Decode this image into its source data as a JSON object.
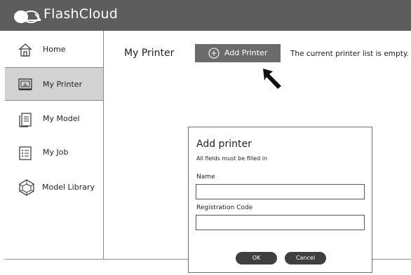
{
  "app": {
    "title": "FlashCloud"
  },
  "sidebar": {
    "items": [
      {
        "label": "Home",
        "icon": "home-icon"
      },
      {
        "label": "My Printer",
        "icon": "printer-icon",
        "active": true
      },
      {
        "label": "My Model",
        "icon": "document-icon"
      },
      {
        "label": "My Job",
        "icon": "list-icon"
      },
      {
        "label": "Model Library",
        "icon": "model-library-icon"
      }
    ]
  },
  "main": {
    "heading": "My Printer",
    "add_button": "Add Printer",
    "empty_message": "The current printer list is empty. I"
  },
  "dialog": {
    "title": "Add printer",
    "subtitle": "All fields must be filled in",
    "fields": [
      {
        "label": "Name",
        "value": ""
      },
      {
        "label": "Registration Code",
        "value": ""
      }
    ],
    "ok_label": "OK",
    "cancel_label": "Cancel"
  },
  "colors": {
    "topbar": "#5d5d5d",
    "active_item": "#d2d2d2",
    "button": "#6b6b6b",
    "pill_button": "#3f3f3f"
  }
}
